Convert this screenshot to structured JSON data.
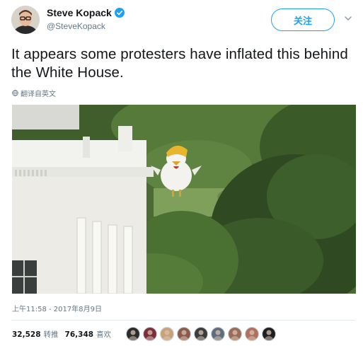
{
  "user": {
    "display_name": "Steve Kopack",
    "handle": "@SteveKopack",
    "verified": true,
    "avatar_icon": "user-avatar-photo",
    "verified_icon": "verified-badge-icon",
    "verified_color": "#1da1f2"
  },
  "follow_button": {
    "label": "关注",
    "color": "#1da1f2"
  },
  "menu_icon": "chevron-down-icon",
  "tweet": {
    "text": "It appears some protesters have inflated this behind the White House.",
    "translate_label": "翻译自英文",
    "translate_icon": "globe-icon",
    "image_icon": "photo-inflatable-chicken-white-house",
    "timestamp": "上午11:58 - 2017年8月9日"
  },
  "stats": {
    "retweets": "32,528",
    "retweets_label": "转推",
    "likes": "76,348",
    "likes_label": "喜欢"
  },
  "liker_avatars": [
    {
      "icon": "liker-avatar-icon",
      "color": "#2b2b2b"
    },
    {
      "icon": "liker-avatar-icon",
      "color": "#7a2f3a"
    },
    {
      "icon": "liker-avatar-icon",
      "color": "#c9a27a"
    },
    {
      "icon": "liker-avatar-icon",
      "color": "#8c5a4a"
    },
    {
      "icon": "liker-avatar-icon",
      "color": "#3b3b3b"
    },
    {
      "icon": "liker-avatar-icon",
      "color": "#5c6e7e"
    },
    {
      "icon": "liker-avatar-icon",
      "color": "#9b6b5a"
    },
    {
      "icon": "liker-avatar-icon",
      "color": "#b07060"
    },
    {
      "icon": "liker-avatar-icon",
      "color": "#1f1f1f"
    }
  ]
}
